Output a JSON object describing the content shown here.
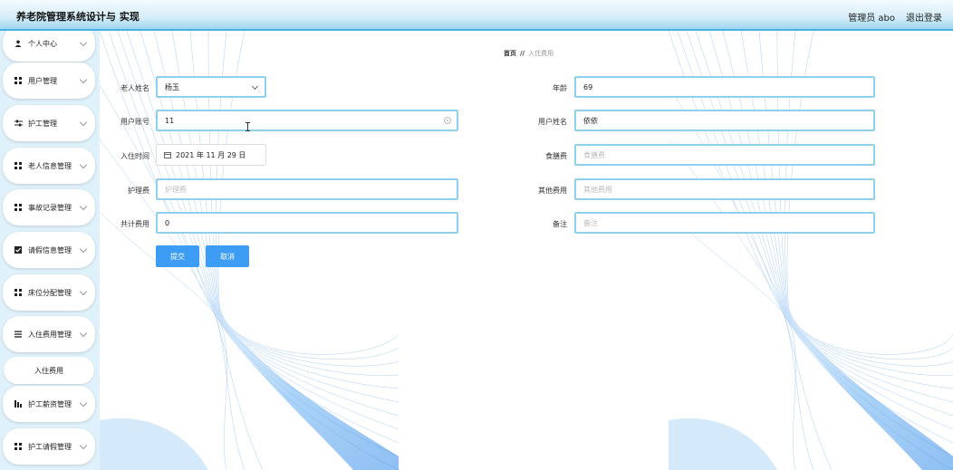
{
  "header": {
    "app_title": "养老院管理系统设计与 实现",
    "user_label": "管理员 abo",
    "logout_label": "退出登录"
  },
  "sidebar": {
    "items": [
      {
        "label": "个人中心",
        "icon": "user-icon"
      },
      {
        "label": "用户管理",
        "icon": "grid-icon"
      },
      {
        "label": "护工管理",
        "icon": "sliders-icon"
      },
      {
        "label": "老人信息管理",
        "icon": "grid-icon"
      },
      {
        "label": "事故记录管理",
        "icon": "grid-icon"
      },
      {
        "label": "请假信息管理",
        "icon": "check-square-icon"
      },
      {
        "label": "床位分配管理",
        "icon": "grid-icon"
      },
      {
        "label": "入住费用管理",
        "icon": "list-icon"
      },
      {
        "label": "护工薪资管理",
        "icon": "bar-chart-icon"
      },
      {
        "label": "护工请假管理",
        "icon": "grid-icon"
      }
    ],
    "sub_item": "入住费用"
  },
  "breadcrumb": {
    "home": "首页",
    "separator": "//",
    "current": "入住费用"
  },
  "form": {
    "elder_name": {
      "label": "老人姓名",
      "value": "杨玉"
    },
    "age": {
      "label": "年龄",
      "value": "69"
    },
    "user_account": {
      "label": "用户账号",
      "value": "11"
    },
    "user_name": {
      "label": "用户姓名",
      "value": "依依"
    },
    "checkin_time": {
      "label": "入住时间",
      "value": "2021 年 11 月 29 日"
    },
    "meal_fee": {
      "label": "食膳费",
      "placeholder": "食膳费"
    },
    "care_fee": {
      "label": "护理费",
      "placeholder": "护理费"
    },
    "other_fee": {
      "label": "其他费用",
      "placeholder": "其他费用"
    },
    "total_fee": {
      "label": "共计费用",
      "value": "0"
    },
    "remark": {
      "label": "备注",
      "placeholder": "备注"
    },
    "submit_label": "提交",
    "cancel_label": "取消"
  },
  "colors": {
    "accent": "#3d9df5",
    "field_border": "#8fd0ec",
    "sidebar_bg": "#dff1fa",
    "header_border": "#4bb0e0"
  }
}
